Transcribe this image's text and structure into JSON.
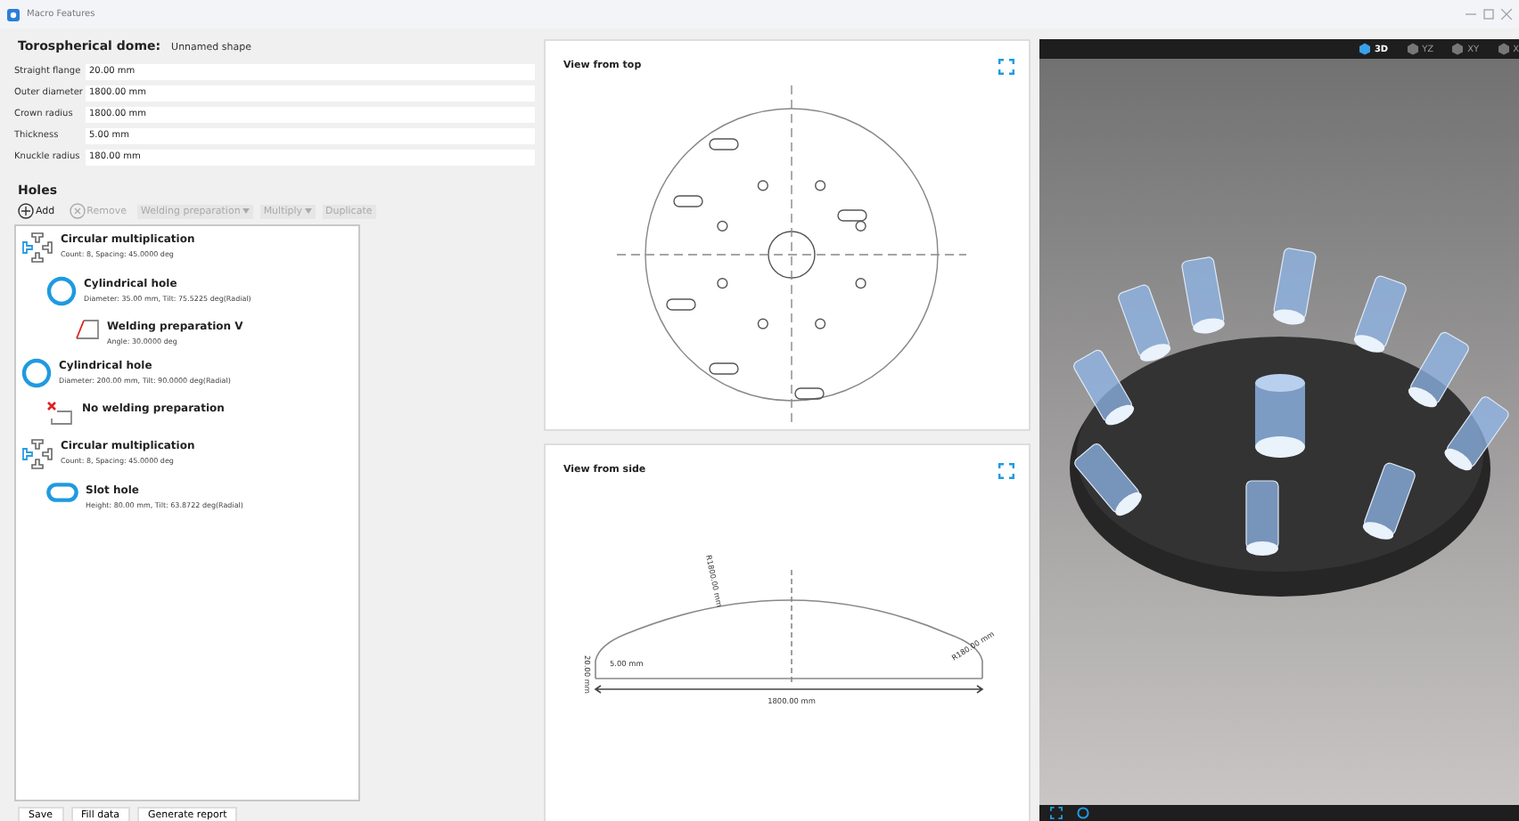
{
  "window": {
    "title": "Macro Features"
  },
  "shape": {
    "type_label": "Torospherical dome:",
    "name": "Unnamed shape"
  },
  "fields": [
    {
      "label": "Straight flange",
      "value": "20.00 mm"
    },
    {
      "label": "Outer diameter",
      "value": "1800.00 mm"
    },
    {
      "label": "Crown radius",
      "value": "1800.00 mm"
    },
    {
      "label": "Thickness",
      "value": "5.00 mm"
    },
    {
      "label": "Knuckle radius",
      "value": "180.00 mm"
    }
  ],
  "holes": {
    "title": "Holes",
    "toolbar": [
      {
        "label": "Add",
        "kind": "add",
        "disabled": false
      },
      {
        "label": "Remove",
        "kind": "remove",
        "disabled": true
      },
      {
        "label": "Welding preparation",
        "kind": "dropdown",
        "disabled": true
      },
      {
        "label": "Multiply",
        "kind": "dropdown",
        "disabled": true
      },
      {
        "label": "Duplicate",
        "kind": "plain",
        "disabled": true
      }
    ],
    "tree": [
      {
        "kind": "multiplication",
        "title": "Circular multiplication",
        "detail": "Count: 8, Spacing: 45.0000 deg",
        "children": [
          {
            "kind": "cylinder",
            "title": "Cylindrical hole",
            "detail": "Diameter: 35.00 mm, Tilt: 75.5225 deg(Radial)",
            "children": [
              {
                "kind": "weld_v",
                "title": "Welding preparation V",
                "detail": "Angle: 30.0000 deg"
              }
            ]
          }
        ]
      },
      {
        "kind": "cylinder",
        "title": "Cylindrical hole",
        "detail": "Diameter: 200.00 mm, Tilt: 90.0000 deg(Radial)",
        "children": [
          {
            "kind": "no_weld",
            "title": "No welding preparation"
          }
        ]
      },
      {
        "kind": "multiplication",
        "title": "Circular multiplication",
        "detail": "Count: 8, Spacing: 45.0000 deg",
        "children": [
          {
            "kind": "slot",
            "title": "Slot hole",
            "detail": "Height: 80.00 mm, Tilt: 63.8722 deg(Radial)"
          }
        ]
      }
    ]
  },
  "footer_buttons": [
    "Save",
    "Fill data",
    "Generate report"
  ],
  "top_view": {
    "title": "View from top"
  },
  "side_view": {
    "title": "View from side",
    "crown_radius": "R1800.00 mm",
    "thickness": "5.00 mm",
    "flange": "20.00 mm",
    "knuckle_radius": "R180.00 mm",
    "diameter": "1800.00 mm"
  },
  "viewport": {
    "views": [
      {
        "label": "3D",
        "selected": true
      },
      {
        "label": "YZ",
        "selected": false
      },
      {
        "label": "XY",
        "selected": false
      },
      {
        "label": "X",
        "selected": false
      }
    ]
  }
}
